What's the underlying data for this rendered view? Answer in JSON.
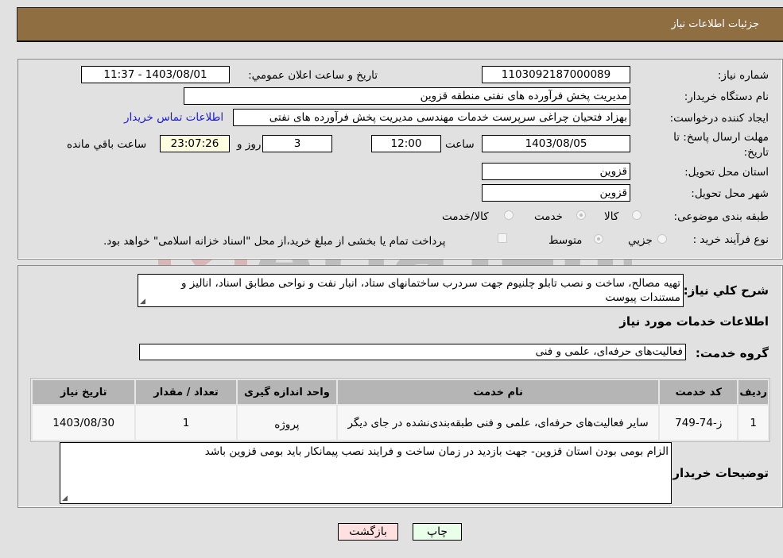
{
  "header": {
    "title": "جزئیات اطلاعات نیاز"
  },
  "form": {
    "need_number": {
      "label": "شماره نیاز:",
      "value": "1103092187000089"
    },
    "announce_datetime": {
      "label": "تاریخ و ساعت اعلان عمومي:",
      "value": "1403/08/01 - 11:37"
    },
    "buyer_org": {
      "label": "نام دستگاه خریدار:",
      "value": "مدیریت پخش فرآورده های نفتی منطقه قزوین"
    },
    "requester": {
      "label": "ایجاد کننده درخواست:",
      "value": "بهزاد فتحیان چراغی سرپرست خدمات مهندسی مدیریت پخش فرآورده های نفتی",
      "contact_link": "اطلاعات تماس خریدار"
    },
    "deadline": {
      "label": "مهلت ارسال پاسخ: تا تاریخ:",
      "date": "1403/08/05",
      "time_label": "ساعت",
      "time": "12:00",
      "days": "3",
      "days_label": "روز و",
      "remaining": "23:07:26",
      "remaining_label": "ساعت باقي مانده"
    },
    "province": {
      "label": "استان محل تحویل:",
      "value": "قزوین"
    },
    "city": {
      "label": "شهر محل تحویل:",
      "value": "قزوین"
    },
    "category": {
      "label": "طبقه بندی موضوعی:",
      "options": [
        {
          "label": "کالا",
          "selected": false
        },
        {
          "label": "خدمت",
          "selected": true
        },
        {
          "label": "کالا/خدمت",
          "selected": false
        }
      ]
    },
    "purchase_type": {
      "label": "نوع فرآیند خرید :",
      "options": [
        {
          "label": "جزيي",
          "selected": false
        },
        {
          "label": "متوسط",
          "selected": true
        }
      ],
      "treasury_checkbox": {
        "label": "پرداخت تمام یا بخشی از مبلغ خرید،از محل \"اسناد خزانه اسلامی\" خواهد بود.",
        "checked": false
      }
    }
  },
  "description": {
    "label": "شرح کلي نیاز:",
    "value": "تهیه مصالح، ساخت و نصب تابلو چلنیوم جهت سردرب ساختمانهای ستاد، انبار نفت و نواحی مطابق اسناد، انالیز و مستندات پیوست"
  },
  "services_section": {
    "title": "اطلاعات خدمات مورد نیاز",
    "group_label": "گروه خدمت:",
    "group_value": "فعالیت‌های حرفه‌ای، علمی و فنی",
    "table": {
      "headers": [
        "ردیف",
        "کد خدمت",
        "نام خدمت",
        "واحد اندازه گیری",
        "تعداد / مقدار",
        "تاریخ نیاز"
      ],
      "rows": [
        [
          "1",
          "ز-74-749",
          "سایر فعالیت‌های حرفه‌ای، علمی و فنی طبقه‌بندی‌نشده در جای دیگر",
          "پروژه",
          "1",
          "1403/08/30"
        ]
      ]
    }
  },
  "buyer_notes": {
    "label": "توضیحات خریدار:",
    "value": "الزام بومی بودن استان قزوین- جهت بازدید در زمان ساخت و فرایند نصب پیمانکار باید بومی قزوین باشد"
  },
  "buttons": {
    "print": "چاپ",
    "back": "بازگشت"
  },
  "colors": {
    "header_bg": "#8f6e42",
    "print_bg": "#eaffea",
    "back_bg": "#ffe0e0",
    "link": "#1a1ad0"
  },
  "watermark": {
    "text": "AriaTender.neT"
  }
}
